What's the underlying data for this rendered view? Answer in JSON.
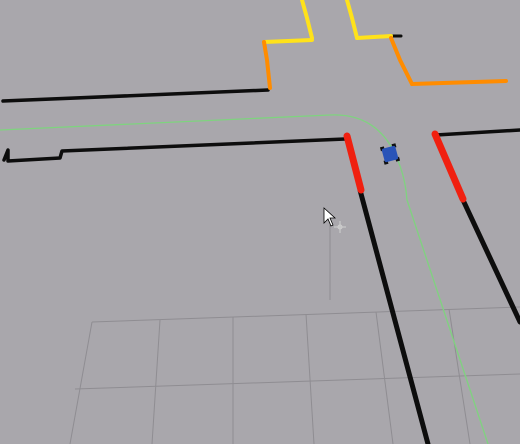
{
  "viewport": {
    "background_color": "#a9a7ac"
  },
  "colors": {
    "wall": "#0d0d0d",
    "grid": "#8f8d92",
    "planned_path": "#7fd37f",
    "robot_body": "#2a54b8",
    "robot_wheels": "#111111",
    "scan_red": "#f02010",
    "scan_orange": "#ff8c00",
    "scan_yellow": "#ffe21a",
    "cursor": "#ffffff",
    "move_tool_handle": "#d0d0d0"
  },
  "icons": {
    "cursor": "mouse-pointer-icon",
    "goal_handle": "move-tool-handle-icon",
    "robot": "robot-icon"
  }
}
